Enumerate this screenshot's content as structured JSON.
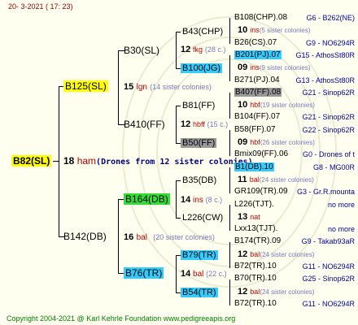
{
  "header": {
    "date": "20-  3-2021 ( 17: 23)"
  },
  "footer": {
    "copyright": "Copyright 2004-2021 @ Karl Kehrle Foundation   www.pedigreeapis.org"
  },
  "root": {
    "label": "B82(SL)",
    "gen": "18",
    "mark": "ham",
    "note": "(Drones from 12 sister colonies)"
  },
  "dam": {
    "label": "B125(SL)",
    "gen": "15",
    "mark": "lgn",
    "note": "(14 sister colonies)"
  },
  "sire": {
    "label": "B142(DB)",
    "gen": "16",
    "mark": "bal",
    "note": "(20 sister colonies)"
  },
  "g3": {
    "b30": {
      "label": "B30(SL)"
    },
    "b410": {
      "label": "B410(FF)"
    },
    "b164": {
      "label": "B164(DB)",
      "gen": "14",
      "mark": "ins",
      "note": "(8 c.)"
    },
    "b76": {
      "label": "B76(TR)",
      "gen": "14",
      "mark": "bal",
      "note": "(22 c.)"
    }
  },
  "g4": {
    "b43": {
      "label": "B43(CHP)",
      "gen": "12",
      "mark": "fkg",
      "note": "(28 c.)"
    },
    "b100": {
      "label": "B100(JG)"
    },
    "b81": {
      "label": "B81(FF)",
      "gen": "12",
      "mark": "hbff",
      "note": "(15 c.)"
    },
    "b50": {
      "label": "B50(FF)"
    },
    "b35": {
      "label": "B35(DB)"
    },
    "l226": {
      "label": "L226(CW)"
    },
    "b79": {
      "label": "B79(TR)"
    },
    "b54": {
      "label": "B54(TR)"
    }
  },
  "rows": [
    {
      "label": "B108(CHP).08",
      "code": "G6 - B262(NE)"
    },
    {
      "gen": "10",
      "mark": "ins",
      "note": "(5 sister colonies)"
    },
    {
      "label": "B26(CS).07",
      "code": "G9 - NO6294R"
    },
    {
      "label": "B201(PJ).07",
      "code": "G15 - AthosSt80R"
    },
    {
      "gen": "09",
      "mark": "ins",
      "note": "(9 sister colonies)"
    },
    {
      "label": "B271(PJ).04",
      "code": "G13 - AthosSt80R"
    },
    {
      "label": "B407(FF).08",
      "code": "G21 - Sinop62R"
    },
    {
      "gen": "10",
      "mark": "hbf",
      "note": "(19 sister colonies)"
    },
    {
      "label": "B104(FF).07",
      "code": "G21 - Sinop62R"
    },
    {
      "label": "B58(FF).07",
      "code": "G22 - Sinop62R"
    },
    {
      "gen": "09",
      "mark": "hbf",
      "note": "(26 sister colonies)"
    },
    {
      "label": "Bmix09(FF).06",
      "code": "G0 - Drones of t"
    },
    {
      "label": "B1(DB).10",
      "code": "G8 - MG00R"
    },
    {
      "gen": "11",
      "mark": "bal",
      "note": "(24 sister colonies)"
    },
    {
      "label": "GR109(TR).09",
      "code": "G3 - Gr.R.mounta"
    },
    {
      "label": "L226(TJT).",
      "code": "no more"
    },
    {
      "gen": "13",
      "mark": "nat",
      "note": ""
    },
    {
      "label": "Lxx13(TJT).",
      "code": "no more"
    },
    {
      "label": "B174(TR).09",
      "code": "G9 - Takab93aR"
    },
    {
      "gen": "12",
      "mark": "bal",
      "note": "(24 sister colonies)"
    },
    {
      "label": "B72(TR).10",
      "code": "G11 - NO6294R"
    },
    {
      "label": "B70(TR).10",
      "code": "G25 - Sinop62R"
    },
    {
      "gen": "12",
      "mark": "bal",
      "note": "(24 sister colonies)"
    },
    {
      "label": "B72(TR).10",
      "code": "G11 - NO6294R"
    }
  ],
  "colors": {
    "root": "#ffff00",
    "dam": "#ffff00",
    "drone_green": "#33dd33",
    "cyan": "#33ccff",
    "gray": "#999999"
  }
}
